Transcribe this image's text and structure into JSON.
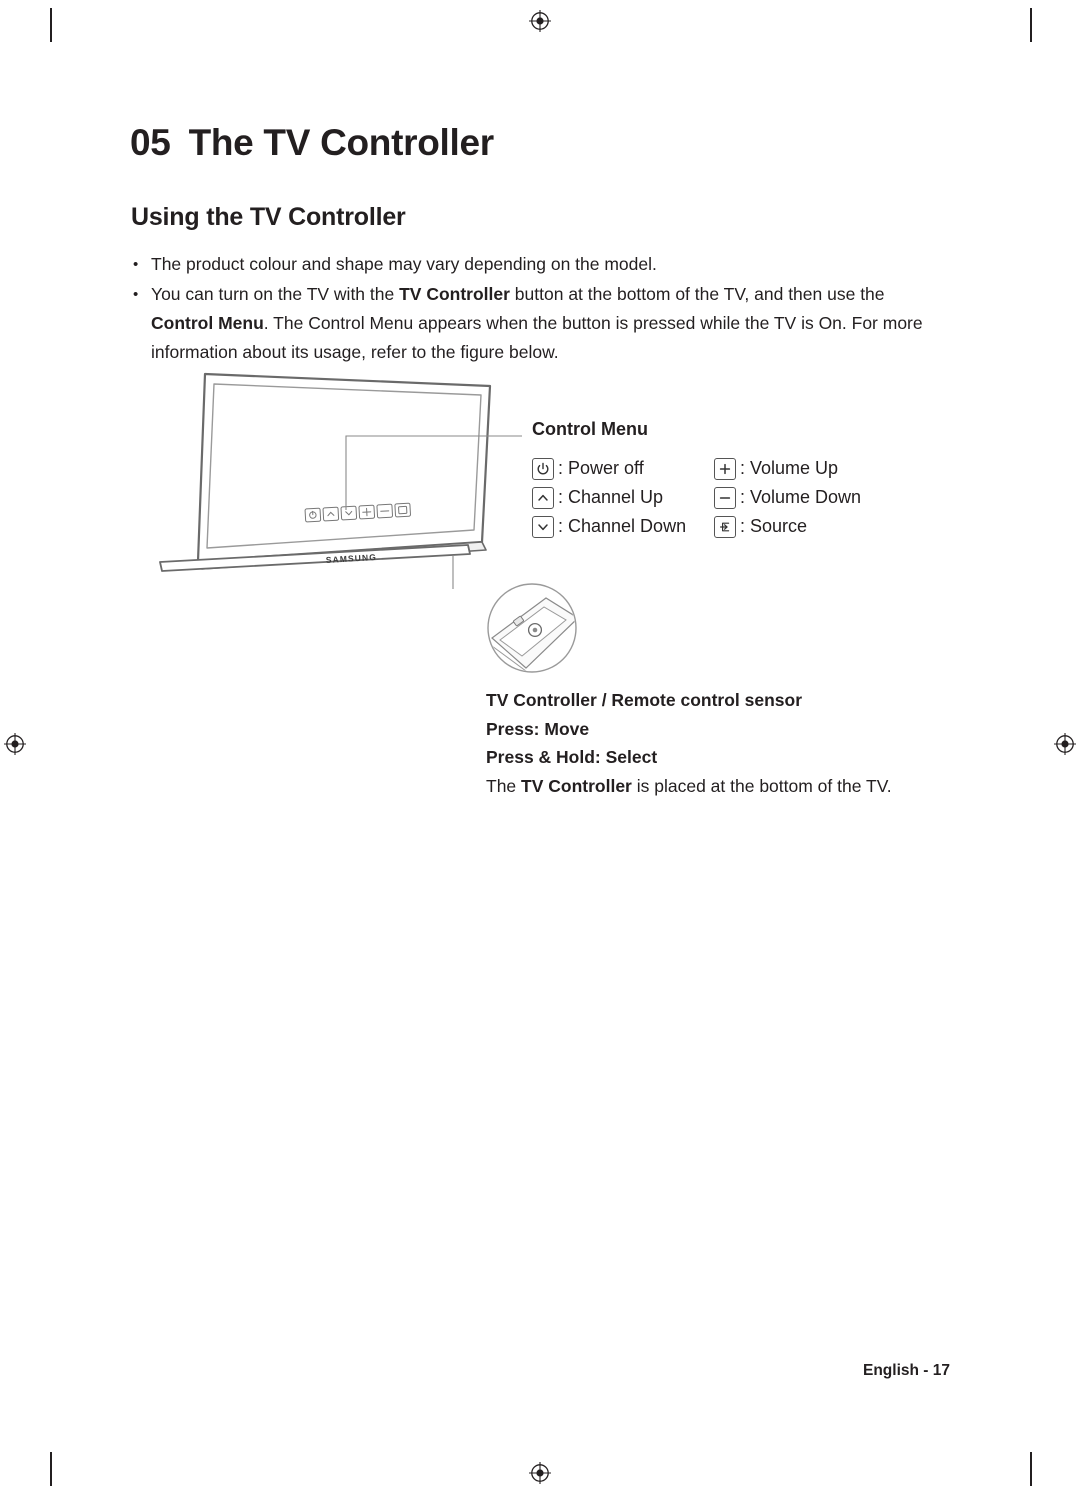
{
  "chapter": {
    "number": "05",
    "title": "The TV Controller"
  },
  "section": {
    "title": "Using the TV Controller"
  },
  "bullets": [
    {
      "marker": "•",
      "html": "The product colour and shape may vary depending on the model."
    },
    {
      "marker": "•",
      "html": "You can turn on the TV with the <b>TV Controller</b> button at the bottom of the TV, and then use the <b>Control Menu</b>. The Control Menu appears when the button is pressed while the TV is On. For more information about its usage, refer to the figure below."
    }
  ],
  "figure": {
    "tv_brand": "SAMSUNG",
    "control_menu_title": "Control Menu",
    "legend": [
      {
        "left_icon": "power-icon",
        "left_label": ": Power off",
        "right_icon": "plus-icon",
        "right_label": ": Volume Up"
      },
      {
        "left_icon": "chevron-up-icon",
        "left_label": ": Channel Up",
        "right_icon": "minus-icon",
        "right_label": ": Volume Down"
      },
      {
        "left_icon": "chevron-down-icon",
        "left_label": ": Channel Down",
        "right_icon": "source-icon",
        "right_label": ": Source"
      }
    ],
    "caption": {
      "line1": "TV Controller / Remote control sensor",
      "line2": "Press: Move",
      "line3": "Press & Hold: Select",
      "line4_pre": "The ",
      "line4_bold": "TV Controller",
      "line4_post": " is placed at the bottom of the TV."
    }
  },
  "footer": {
    "text": "English - 17"
  },
  "colors": {
    "text": "#231f20",
    "line": "#555555",
    "rule": "#bfbfbf"
  }
}
